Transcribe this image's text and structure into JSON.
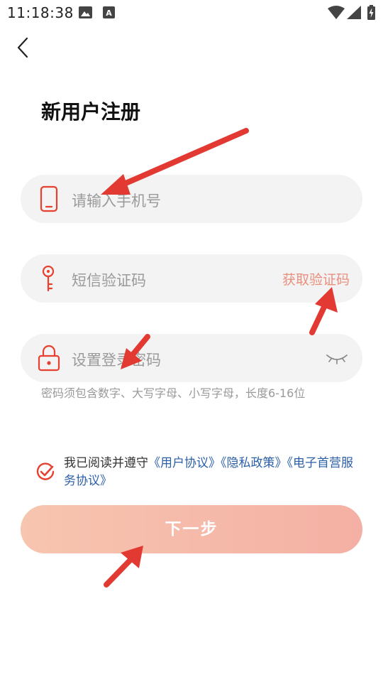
{
  "status_bar": {
    "time": "11:18:38"
  },
  "page": {
    "title": "新用户注册"
  },
  "form": {
    "phone_placeholder": "请输入手机号",
    "sms_placeholder": "短信验证码",
    "get_code_label": "获取验证码",
    "password_placeholder": "设置登录密码",
    "password_hint": "密码须包含数字、大写字母、小写字母，长度6-16位"
  },
  "agreement": {
    "prefix": "我已阅读并遵守",
    "link_user": "《用户协议》",
    "link_privacy": "《隐私政策》",
    "link_service": "《电子首营服务协议》"
  },
  "actions": {
    "next_label": "下一步"
  },
  "colors": {
    "accent_red": "#e8402f",
    "link_blue": "#2b5fa8",
    "button_gradient_start": "#f7c5b0",
    "button_gradient_end": "#f4b0a4"
  }
}
